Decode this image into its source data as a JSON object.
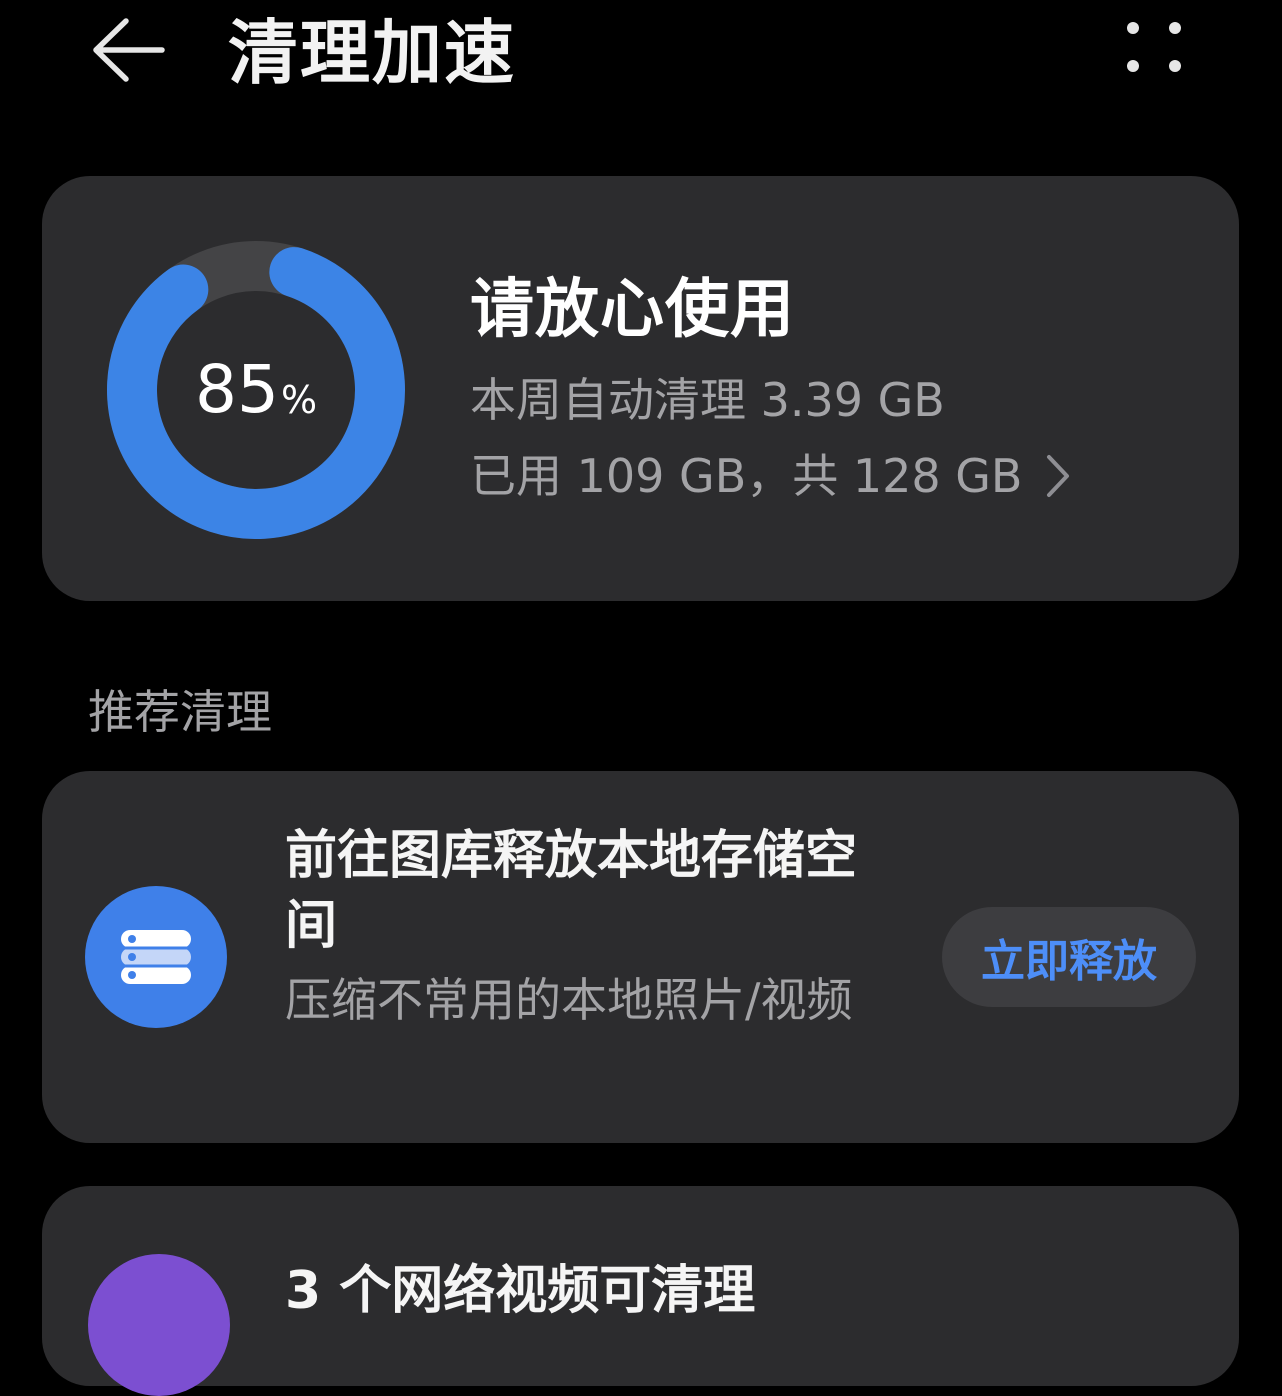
{
  "header": {
    "title": "清理加速",
    "back_icon": "arrow-left-icon",
    "more_icon": "more-dots-icon"
  },
  "storage": {
    "used_percent": 85,
    "percent_value": "85",
    "percent_unit": "%",
    "status": "请放心使用",
    "weekly_cleanup": "本周自动清理 3.39 GB",
    "usage": "已用 109 GB，共 128 GB",
    "ring_color": "#3c84e6",
    "ring_track_color": "#444446"
  },
  "recommend": {
    "section_title": "推荐清理",
    "items": [
      {
        "title": "前往图库释放本地存储空间",
        "description": "压缩不常用的本地照片/视频",
        "button": "立即释放",
        "icon": "storage-stack-icon",
        "icon_color": "#3f80e9"
      },
      {
        "title": "3 个网络视频可清理",
        "icon": "video-icon",
        "icon_color": "#7c4fd1"
      }
    ]
  },
  "colors": {
    "background": "#000000",
    "card": "#2c2c2e",
    "accent": "#4d8ef8",
    "secondary_text": "#a3a3a6"
  }
}
